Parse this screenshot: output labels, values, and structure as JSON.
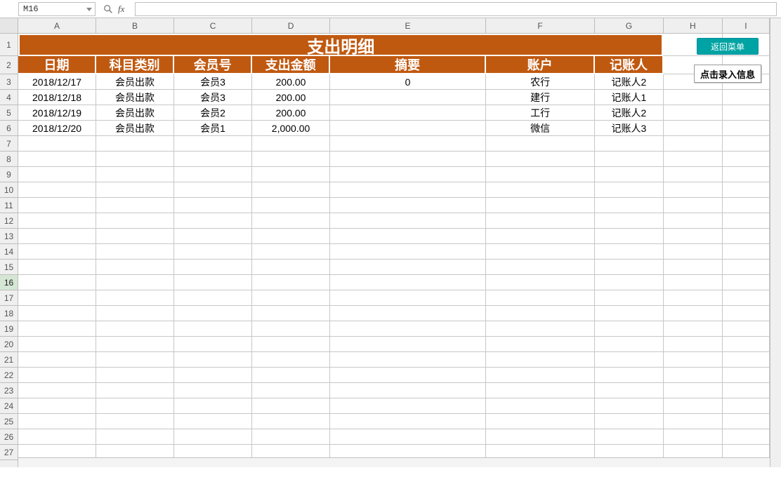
{
  "nameBox": "M16",
  "fxLabel": "fx",
  "formulaValue": "",
  "columns": [
    {
      "letter": "A",
      "cls": "cA"
    },
    {
      "letter": "B",
      "cls": "cB"
    },
    {
      "letter": "C",
      "cls": "cC"
    },
    {
      "letter": "D",
      "cls": "cD"
    },
    {
      "letter": "E",
      "cls": "cE"
    },
    {
      "letter": "F",
      "cls": "cF"
    },
    {
      "letter": "G",
      "cls": "cG"
    },
    {
      "letter": "H",
      "cls": "cH"
    },
    {
      "letter": "I",
      "cls": "cI"
    }
  ],
  "rowNumbers": [
    1,
    2,
    3,
    4,
    5,
    6,
    7,
    8,
    9,
    10,
    11,
    12,
    13,
    14,
    15,
    16,
    17,
    18,
    19,
    20,
    21,
    22,
    23,
    24,
    25,
    26,
    27
  ],
  "selectedRow": 16,
  "title": "支出明细",
  "headers": {
    "A": "日期",
    "B": "科目类别",
    "C": "会员号",
    "D": "支出金额",
    "E": "摘要",
    "F": "账户",
    "G": "记账人"
  },
  "dataRows": [
    {
      "A": "2018/12/17",
      "B": "会员出款",
      "C": "会员3",
      "D": "200.00",
      "E": "0",
      "F": "农行",
      "G": "记账人2"
    },
    {
      "A": "2018/12/18",
      "B": "会员出款",
      "C": "会员3",
      "D": "200.00",
      "E": "",
      "F": "建行",
      "G": "记账人1"
    },
    {
      "A": "2018/12/19",
      "B": "会员出款",
      "C": "会员2",
      "D": "200.00",
      "E": "",
      "F": "工行",
      "G": "记账人2"
    },
    {
      "A": "2018/12/20",
      "B": "会员出款",
      "C": "会员1",
      "D": "2,000.00",
      "E": "",
      "F": "微信",
      "G": "记账人3"
    }
  ],
  "buttons": {
    "return": "返回菜单",
    "enter": "点击录入信息"
  },
  "chart_data": {
    "type": "table",
    "title": "支出明细",
    "columns": [
      "日期",
      "科目类别",
      "会员号",
      "支出金额",
      "摘要",
      "账户",
      "记账人"
    ],
    "rows": [
      [
        "2018/12/17",
        "会员出款",
        "会员3",
        200.0,
        "0",
        "农行",
        "记账人2"
      ],
      [
        "2018/12/18",
        "会员出款",
        "会员3",
        200.0,
        "",
        "建行",
        "记账人1"
      ],
      [
        "2018/12/19",
        "会员出款",
        "会员2",
        200.0,
        "",
        "工行",
        "记账人2"
      ],
      [
        "2018/12/20",
        "会员出款",
        "会员1",
        2000.0,
        "",
        "微信",
        "记账人3"
      ]
    ]
  }
}
